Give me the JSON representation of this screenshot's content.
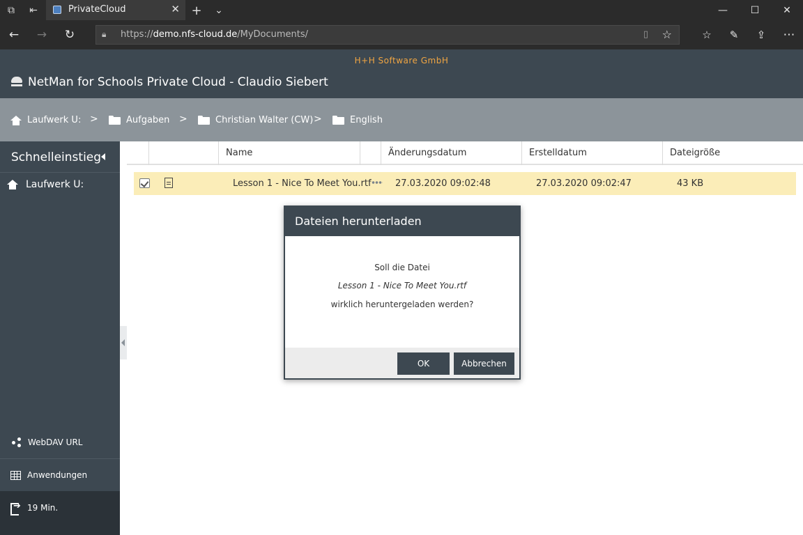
{
  "browser": {
    "tab_title": "PrivateCloud",
    "url_prefix": "https://",
    "url_host": "demo.nfs-cloud.de",
    "url_path": "/MyDocuments/"
  },
  "header": {
    "company": "H+H Software GmbH",
    "title": "NetMan for Schools Private Cloud - Claudio Siebert"
  },
  "breadcrumb": {
    "items": [
      {
        "label": "Laufwerk U:",
        "icon": "home-icon"
      },
      {
        "label": "Aufgaben",
        "icon": "folder-icon"
      },
      {
        "label": "Christian Walter (CW)",
        "icon": "folder-icon"
      },
      {
        "label": "English",
        "icon": "folder-icon"
      }
    ],
    "separator": ">"
  },
  "sidebar": {
    "heading": "Schnelleinstieg",
    "drive": "Laufwerk U:",
    "webdav": "WebDAV URL",
    "apps": "Anwendungen",
    "timer": "19 Min."
  },
  "table": {
    "columns": [
      "Name",
      "Änderungsdatum",
      "Erstelldatum",
      "Dateigröße"
    ],
    "rows": [
      {
        "name": "Lesson 1 - Nice To Meet You.rtf",
        "modified": "27.03.2020 09:02:48",
        "created": "27.03.2020 09:02:47",
        "size": "43 KB",
        "selected": true
      }
    ]
  },
  "dialog": {
    "title": "Dateien herunterladen",
    "line1": "Soll die Datei",
    "filename": "Lesson 1 - Nice To Meet You.rtf",
    "line3": "wirklich heruntergeladen werden?",
    "ok_label": "OK",
    "cancel_label": "Abbrechen"
  },
  "colors": {
    "header_bg": "#3d4851",
    "breadcrumb_bg": "#8c949a",
    "company_accent": "#f0a542",
    "selected_row": "#fbedb8"
  }
}
